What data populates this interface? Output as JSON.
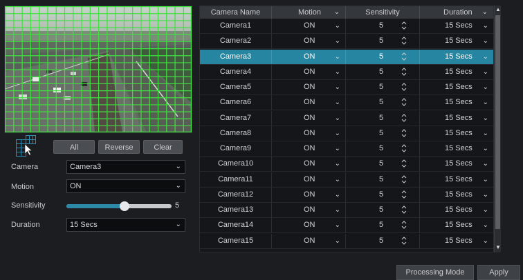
{
  "buttons": {
    "all": "All",
    "reverse": "Reverse",
    "clear": "Clear",
    "processing_mode": "Processing Mode",
    "apply": "Apply"
  },
  "form": {
    "camera_label": "Camera",
    "camera_value": "Camera3",
    "motion_label": "Motion",
    "motion_value": "ON",
    "sensitivity_label": "Sensitivity",
    "sensitivity_value": "5",
    "sensitivity_fraction": 0.55,
    "duration_label": "Duration",
    "duration_value": "15 Secs"
  },
  "table": {
    "headers": {
      "camera_name": "Camera Name",
      "motion": "Motion",
      "sensitivity": "Sensitivity",
      "duration": "Duration"
    },
    "selected_index": 2,
    "rows": [
      {
        "name": "Camera1",
        "motion": "ON",
        "sensitivity": "5",
        "duration": "15 Secs"
      },
      {
        "name": "Camera2",
        "motion": "ON",
        "sensitivity": "5",
        "duration": "15 Secs"
      },
      {
        "name": "Camera3",
        "motion": "ON",
        "sensitivity": "5",
        "duration": "15 Secs"
      },
      {
        "name": "Camera4",
        "motion": "ON",
        "sensitivity": "5",
        "duration": "15 Secs"
      },
      {
        "name": "Camera5",
        "motion": "ON",
        "sensitivity": "5",
        "duration": "15 Secs"
      },
      {
        "name": "Camera6",
        "motion": "ON",
        "sensitivity": "5",
        "duration": "15 Secs"
      },
      {
        "name": "Camera7",
        "motion": "ON",
        "sensitivity": "5",
        "duration": "15 Secs"
      },
      {
        "name": "Camera8",
        "motion": "ON",
        "sensitivity": "5",
        "duration": "15 Secs"
      },
      {
        "name": "Camera9",
        "motion": "ON",
        "sensitivity": "5",
        "duration": "15 Secs"
      },
      {
        "name": "Camera10",
        "motion": "ON",
        "sensitivity": "5",
        "duration": "15 Secs"
      },
      {
        "name": "Camera11",
        "motion": "ON",
        "sensitivity": "5",
        "duration": "15 Secs"
      },
      {
        "name": "Camera12",
        "motion": "ON",
        "sensitivity": "5",
        "duration": "15 Secs"
      },
      {
        "name": "Camera13",
        "motion": "ON",
        "sensitivity": "5",
        "duration": "15 Secs"
      },
      {
        "name": "Camera14",
        "motion": "ON",
        "sensitivity": "5",
        "duration": "15 Secs"
      },
      {
        "name": "Camera15",
        "motion": "ON",
        "sensitivity": "5",
        "duration": "15 Secs"
      }
    ]
  },
  "colors": {
    "selected_row": "#2686a1",
    "grid": "#3fe03f",
    "slider_fill": "#2d8aa6"
  }
}
